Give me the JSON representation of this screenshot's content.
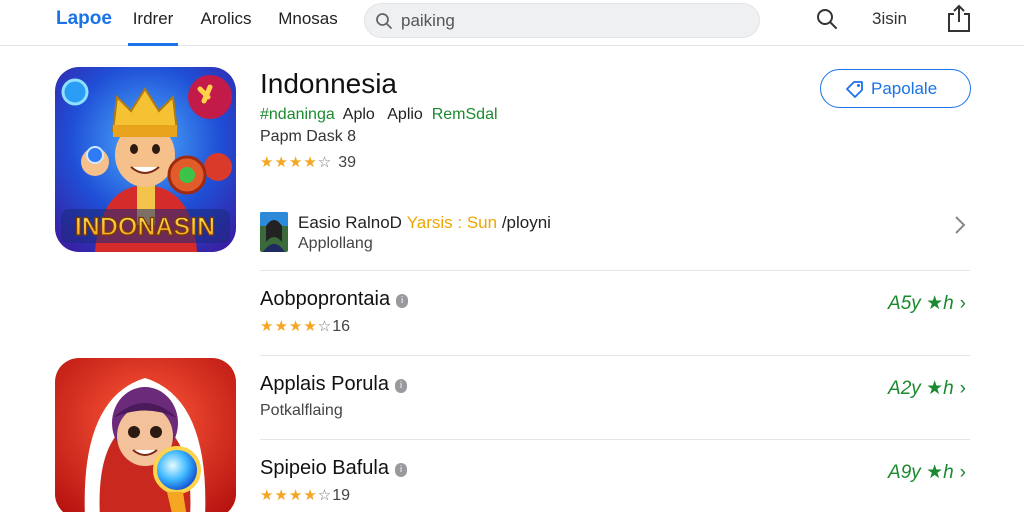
{
  "header": {
    "brand": "Lapoe",
    "tabs": [
      {
        "label": "Irdrer"
      },
      {
        "label": "Arolics"
      },
      {
        "label": "Mnosas"
      }
    ],
    "search": {
      "placeholder": "paiking"
    },
    "right_label": "3isin"
  },
  "app": {
    "title": "Indonnesia",
    "subtitle_green_1": "#ndaninga",
    "subtitle_plain_1": "Aplo",
    "subtitle_plain_2": "Aplio",
    "subtitle_green_2": "RemSdal",
    "developer": "Papm Dask 8",
    "stars_filled": "★★★★",
    "stars_empty": "☆",
    "rating_count": "39",
    "action_button": "Papolale",
    "icon_text": "INDONASIN"
  },
  "developer_row": {
    "name": "Easio RalnoD",
    "highlight": "Yarsis : Sun",
    "suffix": "/ployni",
    "secondary": "Applollang"
  },
  "list": [
    {
      "title": "Aobpoprontaia",
      "sub_stars": "★★★★",
      "sub_star_empty": "☆",
      "sub_text": "16",
      "right": "A5y ★h"
    },
    {
      "title": "Applais Porula",
      "sub_stars": "",
      "sub_star_empty": "",
      "sub_text": "Potkalflaing",
      "right": "A2y ★h"
    },
    {
      "title": "Spipeio Bafula",
      "sub_stars": "★★★★",
      "sub_star_empty": "☆",
      "sub_text": "19",
      "right": "A9y ★h"
    }
  ],
  "colors": {
    "accent": "#1a73e8",
    "green": "#1b8a2e",
    "star": "#f5a623",
    "highlight": "#f0a500"
  },
  "icons": [
    "search-icon",
    "share-icon",
    "chevron-right-icon",
    "info-icon",
    "tag-icon"
  ]
}
